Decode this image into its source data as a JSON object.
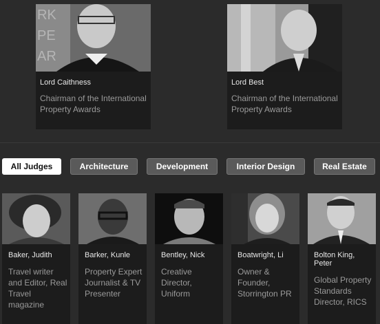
{
  "featured": [
    {
      "name": "Lord Caithness",
      "title": "Chairman of the International Property Awards",
      "photo": "portrait-photo"
    },
    {
      "name": "Lord Best",
      "title": "Chairman of the International Property Awards",
      "photo": "portrait-photo"
    }
  ],
  "filters": {
    "active": "All Judges",
    "tabs": [
      {
        "label": "All Judges"
      },
      {
        "label": "Architecture"
      },
      {
        "label": "Development"
      },
      {
        "label": "Interior Design"
      },
      {
        "label": "Real Estate"
      }
    ]
  },
  "judges": [
    {
      "name": "Baker, Judith",
      "title": "Travel writer and Editor, Real Travel magazine",
      "photo": "portrait-photo"
    },
    {
      "name": "Barker, Kunle",
      "title": "Property Expert Journalist & TV Presenter",
      "photo": "portrait-photo"
    },
    {
      "name": "Bentley, Nick",
      "title": "Creative Director, Uniform",
      "photo": "portrait-photo"
    },
    {
      "name": "Boatwright, Li",
      "title": "Owner & Founder, Storrington PR",
      "photo": "portrait-photo"
    },
    {
      "name": "Bolton King, Peter",
      "title": "Global Property Standards Director, RICS",
      "photo": "portrait-photo"
    }
  ],
  "colors": {
    "background": "#2b2b2b",
    "card": "#1c1c1c",
    "tab": "#5a5a5a",
    "tab_active": "#ffffff"
  }
}
